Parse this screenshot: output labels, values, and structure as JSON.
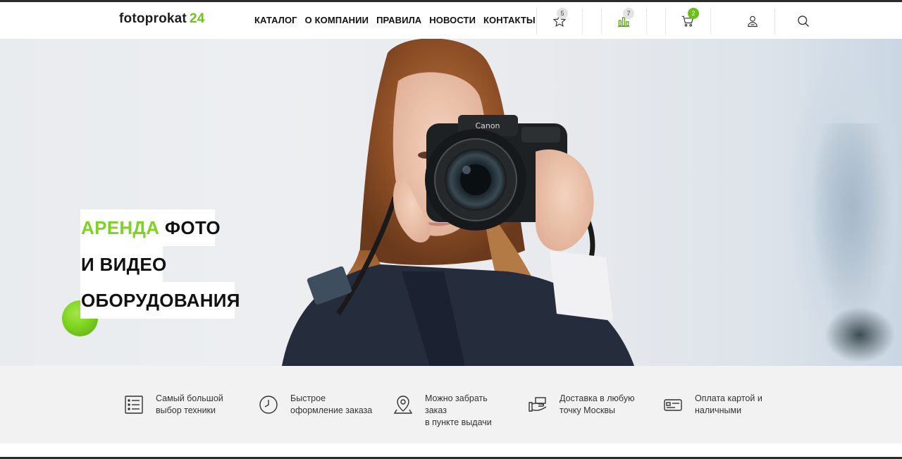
{
  "brand": {
    "name": "fotoprokat",
    "number": "24"
  },
  "nav": [
    "КАТАЛОГ",
    "О КОМПАНИИ",
    "ПРАВИЛА",
    "НОВОСТИ",
    "КОНТАКТЫ"
  ],
  "header_icons": {
    "favorites": {
      "icon": "star-icon",
      "count": "5"
    },
    "compare": {
      "icon": "bar-chart-icon",
      "count": "7"
    },
    "cart": {
      "icon": "cart-icon",
      "count": "2"
    },
    "account": {
      "icon": "user-icon"
    },
    "search": {
      "icon": "search-icon"
    }
  },
  "hero": {
    "line1_accent": "АРЕНДА",
    "line1_rest": " ФОТО",
    "line2": "И ВИДЕО",
    "line3": "ОБОРУДОВАНИЯ"
  },
  "features": [
    {
      "icon": "list-icon",
      "line1": "Самый большой",
      "line2": "выбор техники"
    },
    {
      "icon": "clock-icon",
      "line1": "Быстрое",
      "line2": "оформление заказа"
    },
    {
      "icon": "map-pin-icon",
      "line1": "Можно забрать заказ",
      "line2": "в пункте выдачи"
    },
    {
      "icon": "delivery-icon",
      "line1": "Доставка в любую",
      "line2": "точку Москвы"
    },
    {
      "icon": "credit-card-icon",
      "line1": "Оплата картой и",
      "line2": "наличными"
    }
  ],
  "colors": {
    "accent": "#7ed321",
    "badge_green": "#6cc01a",
    "dark": "#111111"
  }
}
